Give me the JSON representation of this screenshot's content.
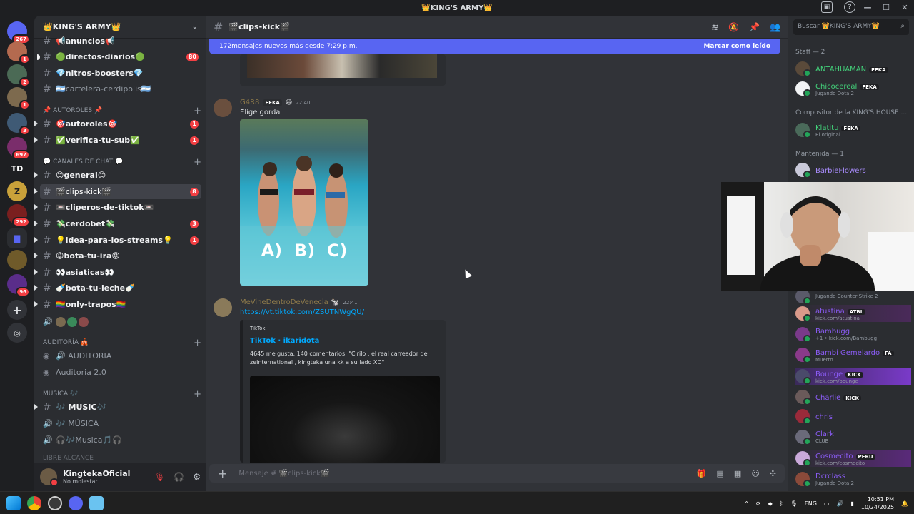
{
  "window": {
    "title": "👑KING'S ARMY👑"
  },
  "servers": [
    {
      "label": "",
      "badge": "267"
    },
    {
      "label": "",
      "badge": "1"
    },
    {
      "label": "",
      "badge": "2"
    },
    {
      "label": "",
      "badge": "1"
    },
    {
      "label": "",
      "badge": "3"
    },
    {
      "label": "",
      "badge": "697"
    },
    {
      "label": "TD",
      "badge": ""
    },
    {
      "label": "Z",
      "badge": ""
    },
    {
      "label": "",
      "badge": "292"
    },
    {
      "label": "",
      "badge": ""
    },
    {
      "label": "",
      "badge": ""
    },
    {
      "label": "",
      "badge": "96"
    }
  ],
  "sidebar": {
    "guild_name": "👑KING'S ARMY👑",
    "channels": [
      {
        "name": "📢anuncios📢",
        "badge": ""
      },
      {
        "name": "🟢directos-diarios🟢",
        "badge": "80"
      },
      {
        "name": "💎nitros-boosters💎",
        "badge": ""
      },
      {
        "name": "🇦🇷cartelera-cerdipolis🇦🇷",
        "badge": ""
      }
    ],
    "cat_autoroles": "📌 AUTOROLES 📌",
    "autoroles": [
      {
        "name": "🎯autoroles🎯",
        "badge": "1"
      },
      {
        "name": "✅verifica-tu-sub✅",
        "badge": "1"
      }
    ],
    "cat_chat": "💬 CANALES DE CHAT 💬",
    "chat": [
      {
        "name": "😊general😊",
        "badge": ""
      },
      {
        "name": "🎬clips-kick🎬",
        "badge": "8"
      },
      {
        "name": "📼cliperos-de-tiktok📼",
        "badge": ""
      },
      {
        "name": "💸cerdobet💸",
        "badge": "3"
      },
      {
        "name": "💡idea-para-los-streams💡",
        "badge": "1"
      },
      {
        "name": "😡bota-tu-ira😡",
        "badge": ""
      },
      {
        "name": "👀asiaticas👀",
        "badge": ""
      },
      {
        "name": "🍼bota-tu-leche🍼",
        "badge": ""
      },
      {
        "name": "🏳️‍🌈only-trapos🏳️‍🌈",
        "badge": ""
      }
    ],
    "cat_auditoria": "AUDITORÍA 🎪",
    "auditoria": [
      "🔊 AUDITORIA",
      "Auditoria 2.0"
    ],
    "cat_musica": "MÚSICA 🎶",
    "musica": [
      "🎶 MUSIC🎶",
      "🎶 MÚSICA",
      "🎧🎶Musica🎵🎧"
    ],
    "cat_cut": "LIBRE ALCANCE"
  },
  "user": {
    "name": "KingtekaOficial",
    "status": "No molestar"
  },
  "channel": {
    "name": "🎬clips-kick🎬"
  },
  "new_messages": {
    "text": "172mensajes nuevos más desde 7:29 p.m.",
    "mark": "Marcar como leído"
  },
  "messages": [
    {
      "author": "G4R8",
      "tag": "FEKA",
      "time": "22:40",
      "text": "Elige gorda",
      "image_caption": "A)  B)  C)"
    },
    {
      "author": "MeVineDentroDeVenecia 🐄",
      "time": "22:41",
      "link": "https://vt.tiktok.com/ZSUTNWgQU/",
      "embed": {
        "provider": "TikTok",
        "title": "TikTok · ikaridota",
        "desc": "4645 me gusta, 140 comentarios. \"Cirilo , el real carreador del zeinternational , kingteka una kk a su lado XD\""
      }
    }
  ],
  "composer": {
    "placeholder": "Mensaje # 🎬clips-kick🎬"
  },
  "members": {
    "search_placeholder": "Buscar 👑KING'S ARMY👑",
    "groups": [
      {
        "label": "Staff — 2"
      },
      {
        "label": "Compositor de la KING'S HOUSE ..."
      },
      {
        "label": "Mantenida — 1"
      }
    ],
    "list": [
      {
        "name": "ANTAHUAMAN",
        "tag": "FEKA",
        "sub": "",
        "color": "#43d17a"
      },
      {
        "name": "Chicocereal",
        "tag": "FEKA",
        "sub": "Jugando Dota 2",
        "color": "#43d17a"
      },
      {
        "name": "Klatitu",
        "tag": "FEKA",
        "sub": "El original",
        "color": "#43d17a"
      },
      {
        "name": "BarbieFlowers",
        "tag": "",
        "sub": "",
        "color": "#a78bfa"
      },
      {
        "name": "",
        "tag": "",
        "sub": "Jugando Counter-Strike 2",
        "color": "#a78bfa"
      },
      {
        "name": "atustina",
        "tag": "ATBL",
        "sub": "kick.com/atustina",
        "color": "#8b5cf6"
      },
      {
        "name": "Bambugg",
        "tag": "",
        "sub": "+1 • kick.com/Bambugg",
        "color": "#8b5cf6"
      },
      {
        "name": "Bambi Gemelardo",
        "tag": "FA",
        "sub": "Muerto",
        "color": "#8b5cf6"
      },
      {
        "name": "Bounge",
        "tag": "KICK",
        "sub": "kick.com/bounge",
        "color": "#8b5cf6"
      },
      {
        "name": "Charlie",
        "tag": "KICK",
        "sub": "",
        "color": "#8b5cf6"
      },
      {
        "name": "chris",
        "tag": "",
        "sub": "",
        "color": "#8b5cf6"
      },
      {
        "name": "Clark",
        "tag": "",
        "sub": "CLUB",
        "color": "#8b5cf6"
      },
      {
        "name": "Cosmecito",
        "tag": "PERU",
        "sub": "kick.com/cosmecito",
        "color": "#8b5cf6"
      },
      {
        "name": "Dcrclass",
        "tag": "",
        "sub": "Jugando Dota 2",
        "color": "#8b5cf6"
      }
    ]
  },
  "taskbar": {
    "lang": "ENG",
    "time": "10:51 PM",
    "date": "10/24/2025"
  }
}
